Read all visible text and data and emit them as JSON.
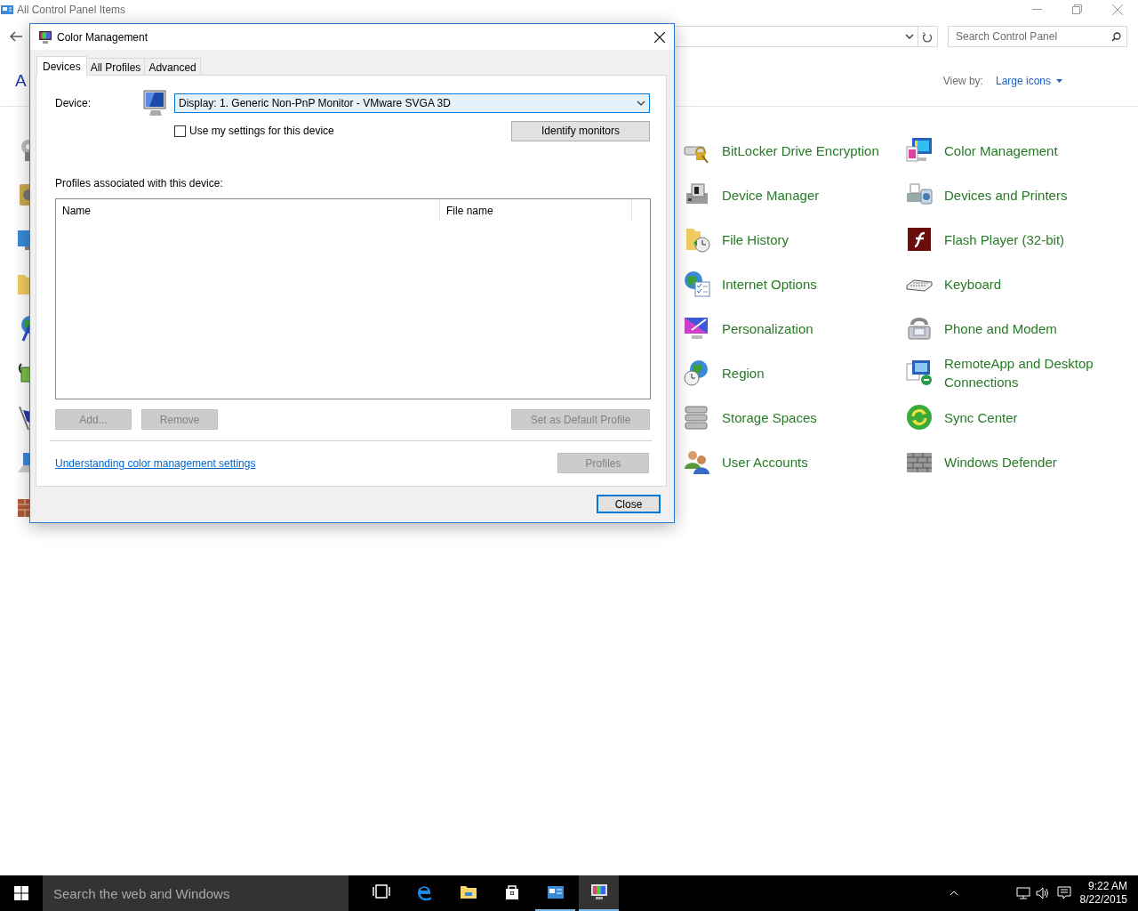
{
  "explorer": {
    "title": "All Control Panel Items",
    "search": {
      "placeholder": "Search Control Panel"
    },
    "heading": "A",
    "view_by_label": "View by:",
    "view_by_value": "Large icons",
    "items": [
      {
        "label": "BitLocker Drive Encryption"
      },
      {
        "label": "Device Manager"
      },
      {
        "label": "File History"
      },
      {
        "label": "Internet Options"
      },
      {
        "label": "Personalization"
      },
      {
        "label": "Region"
      },
      {
        "label": "Storage Spaces"
      },
      {
        "label": "User Accounts"
      },
      {
        "label": "Color Management"
      },
      {
        "label": "Devices and Printers"
      },
      {
        "label": "Flash Player (32-bit)"
      },
      {
        "label": "Keyboard"
      },
      {
        "label": "Phone and Modem"
      },
      {
        "label": "RemoteApp and Desktop Connections"
      },
      {
        "label": "Sync Center"
      },
      {
        "label": "Windows Defender"
      }
    ]
  },
  "dialog": {
    "title": "Color Management",
    "tabs": [
      {
        "label": "Devices",
        "selected": true
      },
      {
        "label": "All Profiles",
        "selected": false
      },
      {
        "label": "Advanced",
        "selected": false
      }
    ],
    "device_label": "Device:",
    "device_value": "Display: 1. Generic Non-PnP Monitor - VMware SVGA 3D",
    "checkbox": {
      "label": "Use my settings for this device",
      "checked": false
    },
    "identify_button": "Identify monitors",
    "profiles_label": "Profiles associated with this device:",
    "table": {
      "columns": [
        "Name",
        "File name"
      ]
    },
    "buttons": [
      {
        "label": "Add...",
        "disabled": true
      },
      {
        "label": "Remove",
        "disabled": true
      },
      {
        "label": "Set as Default Profile",
        "disabled": true
      }
    ],
    "link": "Understanding color management settings",
    "profiles_button": {
      "label": "Profiles",
      "disabled": true
    },
    "close_button": "Close"
  },
  "taskbar": {
    "search": {
      "placeholder": "Search the web and Windows"
    },
    "apps": [
      {
        "running": false,
        "selected": false
      },
      {
        "running": false,
        "selected": false
      },
      {
        "running": false,
        "selected": false
      },
      {
        "running": false,
        "selected": false
      },
      {
        "running": true,
        "selected": false
      },
      {
        "running": true,
        "selected": true
      }
    ],
    "time": "9:22 AM",
    "date": "8/22/2015"
  }
}
